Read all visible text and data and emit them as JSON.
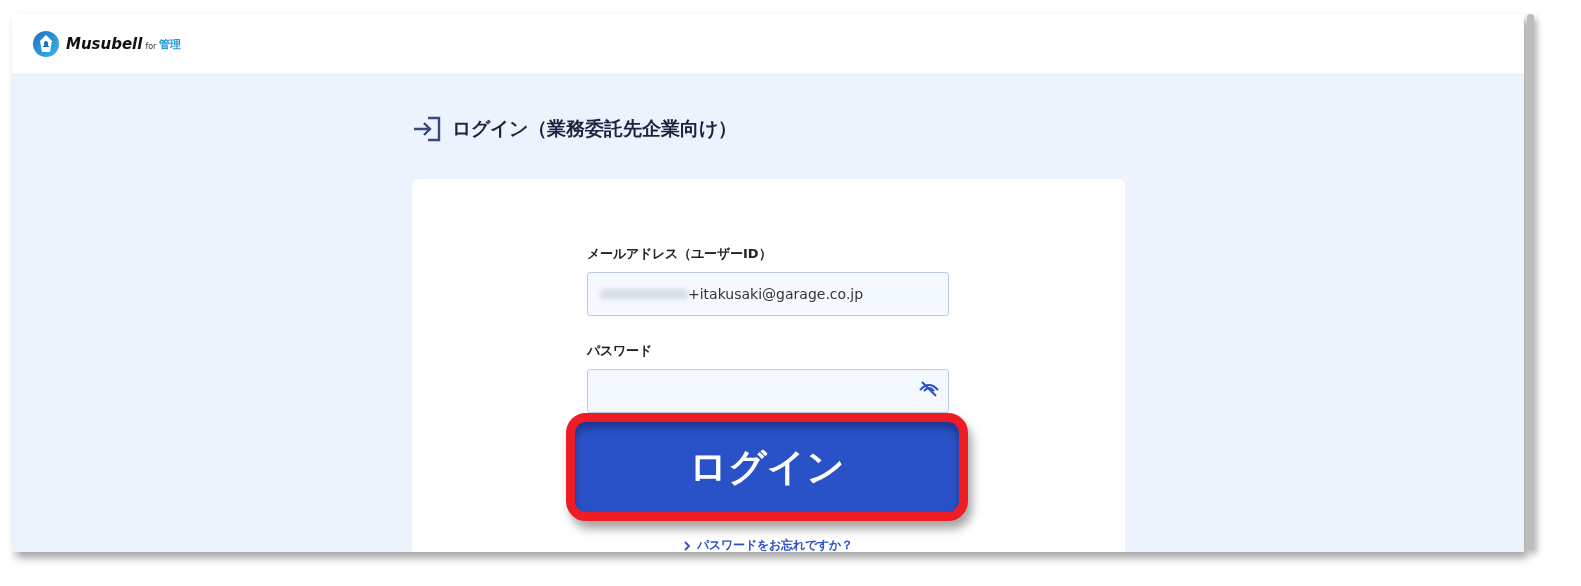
{
  "header": {
    "logo_text": "Musubell",
    "logo_for": "for",
    "logo_suffix": "管理"
  },
  "page_title": "ログイン（業務委託先企業向け）",
  "form": {
    "email": {
      "label": "メールアドレス（ユーザーID）",
      "value": "+itakusaki@garage.co.jp",
      "redacted": true
    },
    "password": {
      "label": "パスワード",
      "visibility_icon": true
    },
    "forgot_link": "パスワードをお忘れですか？"
  },
  "callout": {
    "text": "ログイン",
    "highlighted": true
  }
}
